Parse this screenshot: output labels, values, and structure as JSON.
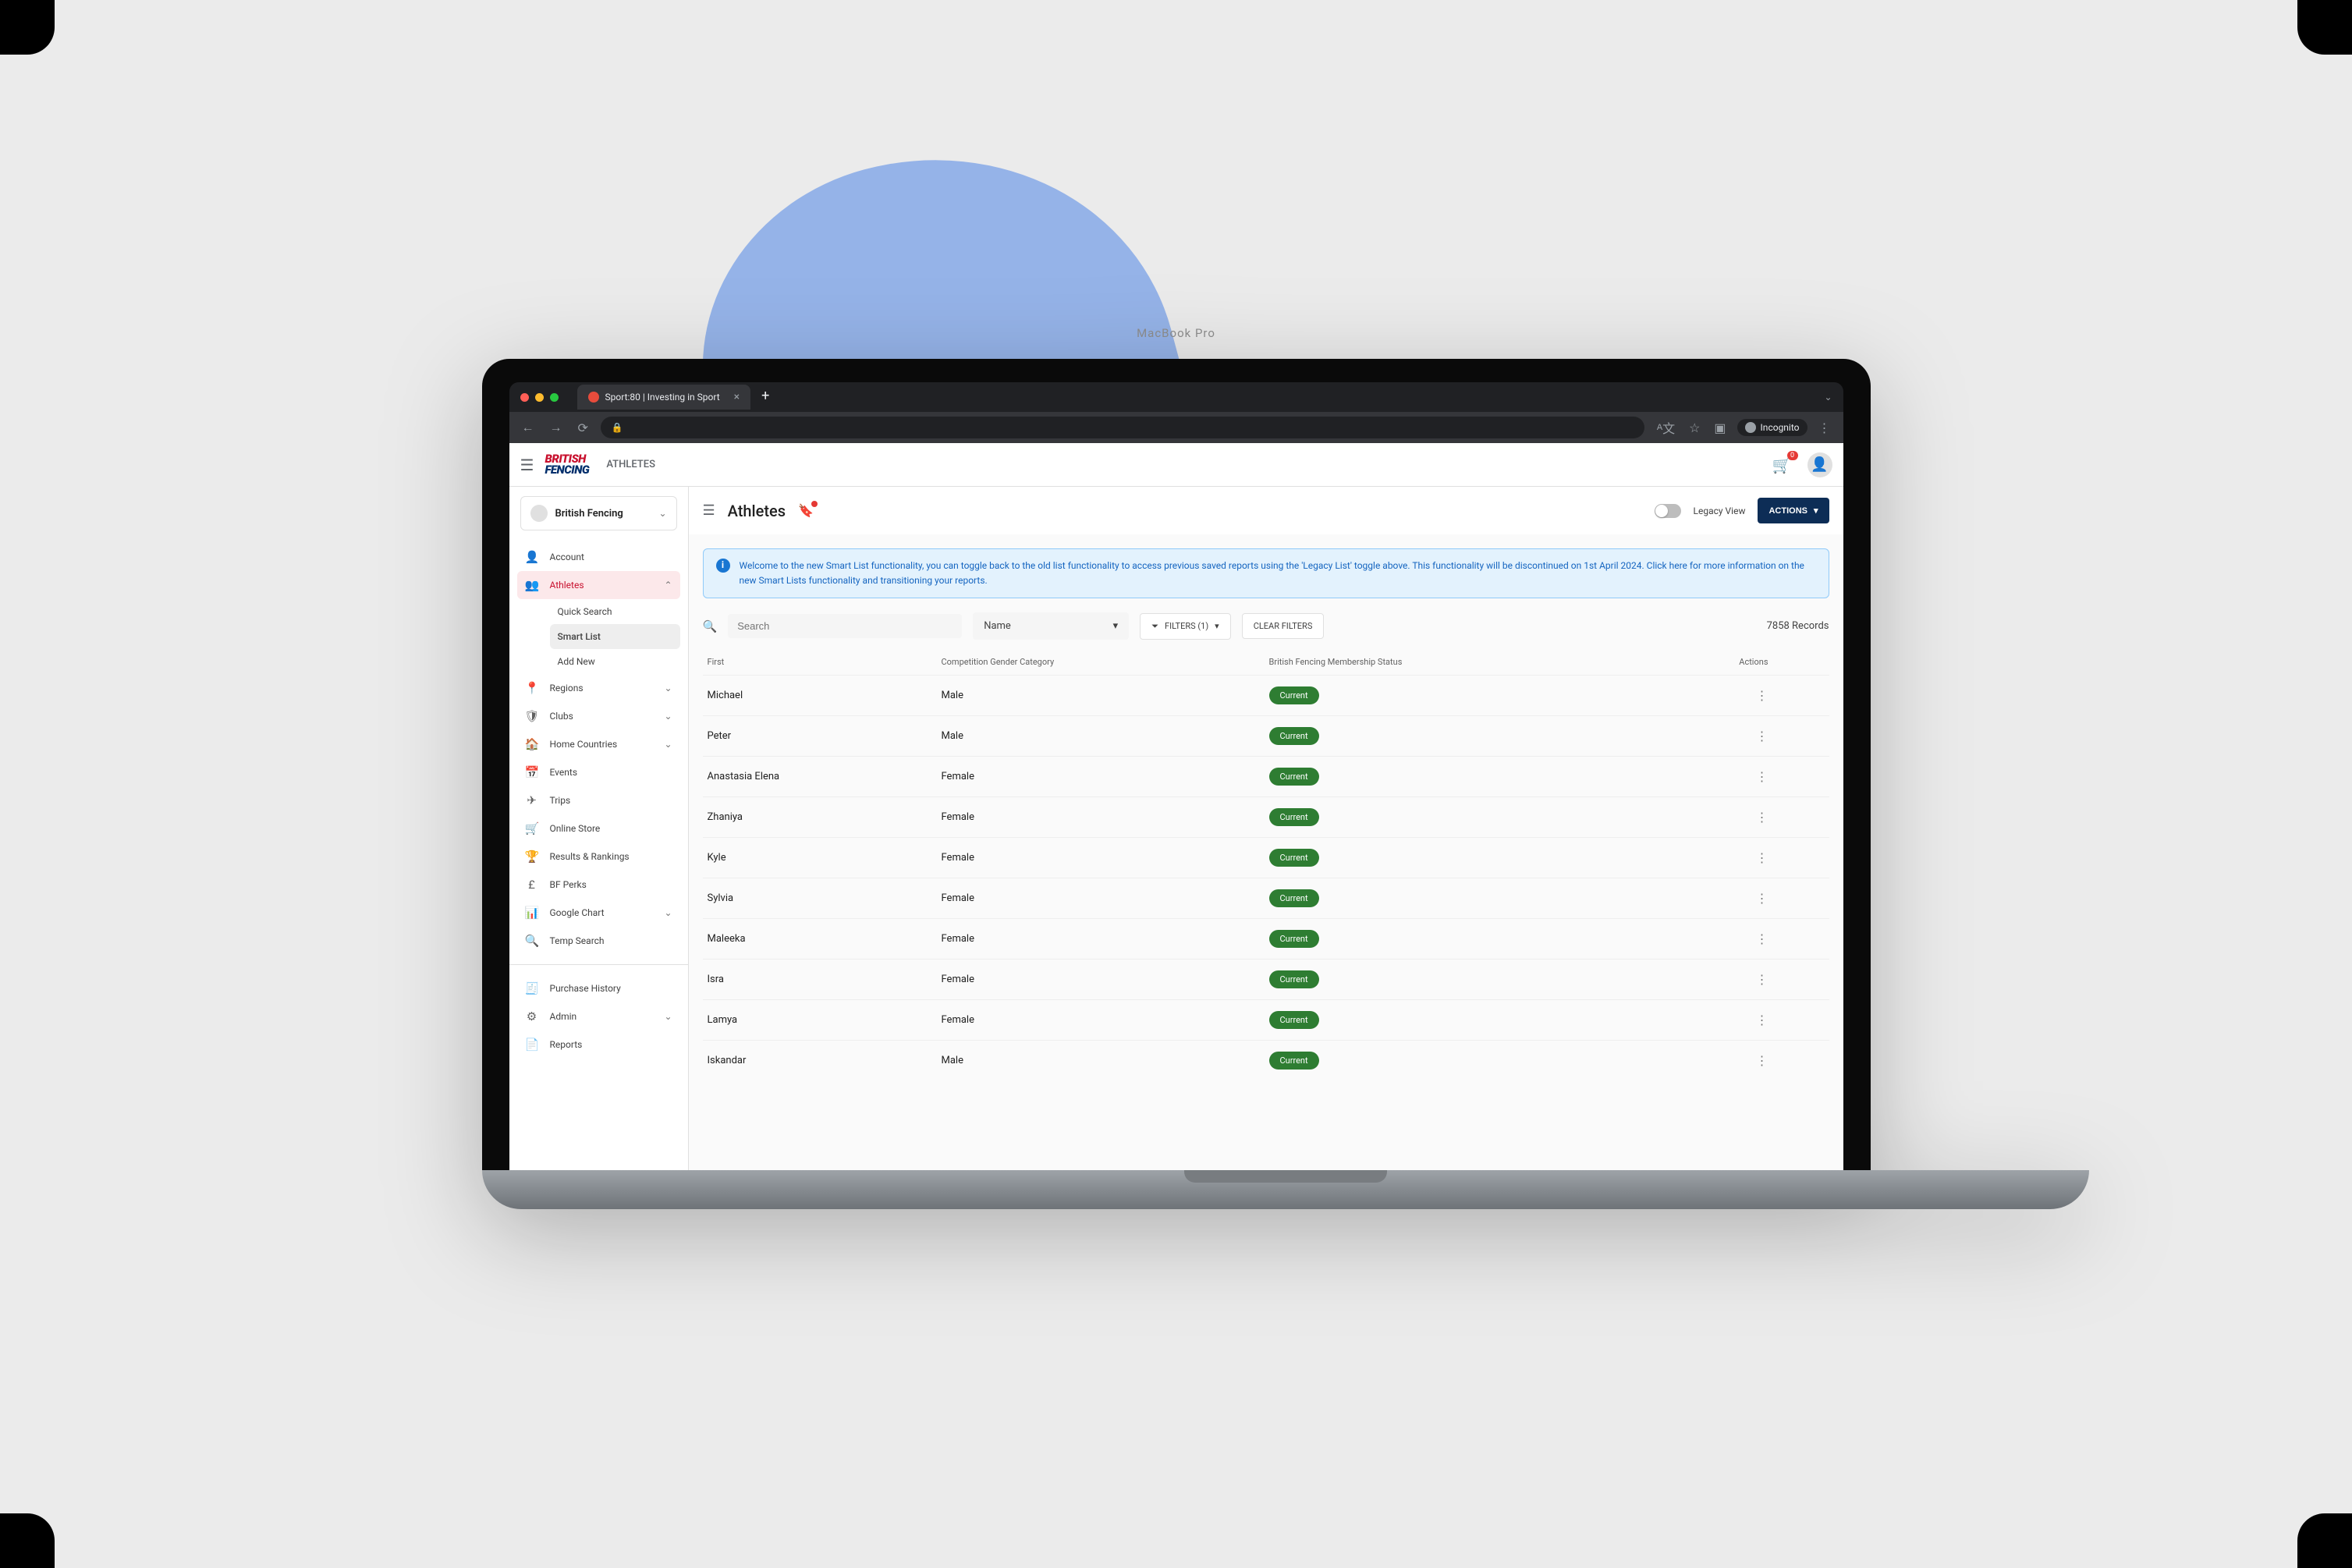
{
  "browser": {
    "tab_title": "Sport:80 | Investing in Sport",
    "incognito_label": "Incognito"
  },
  "header": {
    "logo_top": "BRITISH",
    "logo_bottom": "FENCING",
    "breadcrumb": "ATHLETES",
    "cart_badge": "0"
  },
  "sidebar": {
    "org": "British Fencing",
    "items": [
      {
        "icon": "👤",
        "label": "Account",
        "expand": false
      },
      {
        "icon": "👥",
        "label": "Athletes",
        "expand": true,
        "active": true
      },
      {
        "icon": "📍",
        "label": "Regions",
        "expand": true
      },
      {
        "icon": "🛡",
        "label": "Clubs",
        "expand": true
      },
      {
        "icon": "🏠",
        "label": "Home Countries",
        "expand": true
      },
      {
        "icon": "📅",
        "label": "Events",
        "expand": false
      },
      {
        "icon": "✈",
        "label": "Trips",
        "expand": false
      },
      {
        "icon": "🛒",
        "label": "Online Store",
        "expand": false
      },
      {
        "icon": "🏆",
        "label": "Results & Rankings",
        "expand": false
      },
      {
        "icon": "£",
        "label": "BF Perks",
        "expand": false
      },
      {
        "icon": "📊",
        "label": "Google Chart",
        "expand": true
      },
      {
        "icon": "🔍",
        "label": "Temp Search",
        "expand": false
      }
    ],
    "athletes_sub": [
      "Quick Search",
      "Smart List",
      "Add New"
    ],
    "footer_items": [
      {
        "icon": "🧾",
        "label": "Purchase History",
        "expand": false
      },
      {
        "icon": "⚙",
        "label": "Admin",
        "expand": true
      },
      {
        "icon": "📄",
        "label": "Reports",
        "expand": false
      }
    ]
  },
  "page": {
    "title": "Athletes",
    "legacy_label": "Legacy View",
    "actions_label": "ACTIONS",
    "alert": "Welcome to the new Smart List functionality, you can toggle back to the old list functionality to access previous saved reports using the 'Legacy List' toggle above. This functionality will be discontinued on 1st April 2024. Click here for more information on the new Smart Lists functionality and transitioning your reports.",
    "search_placeholder": "Search",
    "sort_by": "Name",
    "filters_label": "FILTERS (1)",
    "clear_label": "CLEAR FILTERS",
    "records": "7858 Records",
    "columns": {
      "first": "First",
      "gender": "Competition Gender Category",
      "status": "British Fencing Membership Status",
      "actions": "Actions"
    },
    "rows": [
      {
        "first": "Michael",
        "gender": "Male",
        "status": "Current"
      },
      {
        "first": "Peter",
        "gender": "Male",
        "status": "Current"
      },
      {
        "first": "Anastasia Elena",
        "gender": "Female",
        "status": "Current"
      },
      {
        "first": "Zhaniya",
        "gender": "Female",
        "status": "Current"
      },
      {
        "first": "Kyle",
        "gender": "Female",
        "status": "Current"
      },
      {
        "first": "Sylvia",
        "gender": "Female",
        "status": "Current"
      },
      {
        "first": "Maleeka",
        "gender": "Female",
        "status": "Current"
      },
      {
        "first": "Isra",
        "gender": "Female",
        "status": "Current"
      },
      {
        "first": "Lamya",
        "gender": "Female",
        "status": "Current"
      },
      {
        "first": "Iskandar",
        "gender": "Male",
        "status": "Current"
      }
    ]
  },
  "laptop": {
    "brand": "MacBook Pro"
  }
}
